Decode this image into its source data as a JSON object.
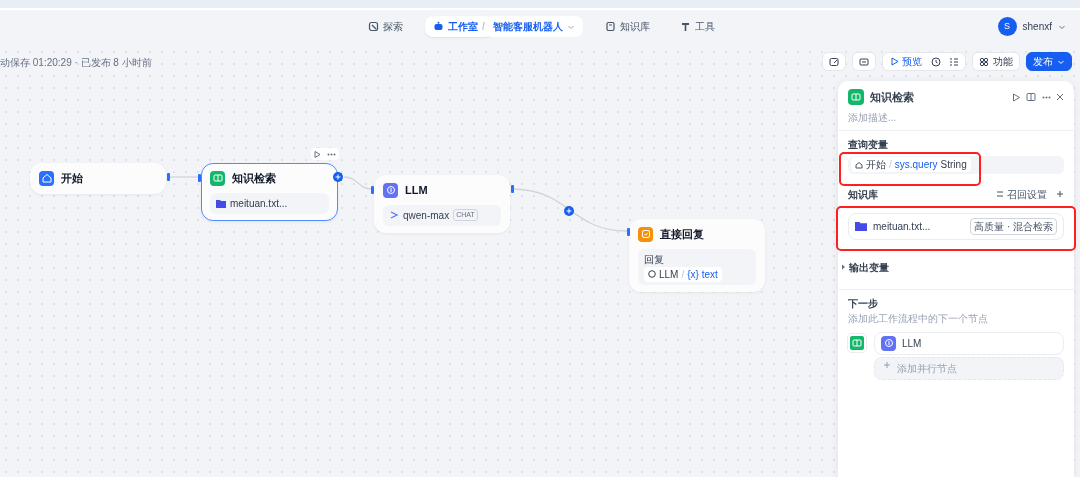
{
  "nav": {
    "items": [
      {
        "kind": "explore",
        "label": "探索",
        "selected": false
      },
      {
        "kind": "studio",
        "label": "工作室",
        "separator": "/",
        "sub": "智能客服机器人",
        "selected": true
      },
      {
        "kind": "knowledge",
        "label": "知识库",
        "selected": false
      },
      {
        "kind": "tools",
        "label": "工具",
        "selected": false
      }
    ]
  },
  "user": {
    "avatar": "S",
    "name": "shenxf"
  },
  "status": "动保存 01:20:29 · 已发布 8 小时前",
  "toolbar": {
    "preview": "预览",
    "features": "功能",
    "publish": "发布"
  },
  "nodes": [
    {
      "kind": "start",
      "title": "开始",
      "selected": false
    },
    {
      "kind": "knowledge",
      "title": "知识检索",
      "file": "meituan.txt...",
      "selected": true
    },
    {
      "kind": "llm",
      "title": "LLM",
      "model": "qwen-max",
      "mode": "CHAT",
      "selected": false
    },
    {
      "kind": "answer",
      "title": "直接回复",
      "field_label": "回复",
      "source": "LLM",
      "separator": "/",
      "variable_icon": "{x}",
      "variable": "text",
      "selected": false
    }
  ],
  "panel": {
    "title": "知识检索",
    "description_placeholder": "添加描述...",
    "query_label": "查询变量",
    "query": {
      "node": "开始",
      "separator": "/",
      "variable": "sys.query",
      "type": "String",
      "highlighted": true
    },
    "knowledge_label": "知识库",
    "recall_settings": "召回设置",
    "datasets": [
      {
        "name": "meituan.txt...",
        "tags": "高质量 · 混合检索",
        "highlighted": true
      }
    ],
    "output_label": "输出变量",
    "next_title": "下一步",
    "next_desc": "添加此工作流程中的下一个节点",
    "next_nodes": [
      {
        "title": "LLM"
      }
    ],
    "add_parallel": "添加并行节点"
  }
}
